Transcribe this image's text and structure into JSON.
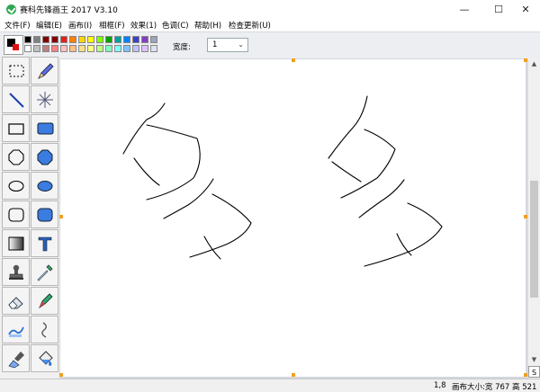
{
  "window": {
    "title": "赛科先锋画王 2017 V3.10",
    "min_glyph": "—",
    "max_glyph": "☐",
    "close_glyph": "✕"
  },
  "menu": [
    {
      "label": "文件(F)"
    },
    {
      "label": "编辑(E)"
    },
    {
      "label": "画布(I)"
    },
    {
      "label": "相框(F)"
    },
    {
      "label": "效果(1)"
    },
    {
      "label": "色调(C)"
    },
    {
      "label": "帮助(H)"
    },
    {
      "label": "检查更新(U)"
    }
  ],
  "toolbar": {
    "width_label": "宽度:",
    "width_value": "1",
    "foreground_color": "#000000",
    "background_color": "#e01010",
    "palette_row1": [
      "#000000",
      "#808080",
      "#800000",
      "#800000",
      "#e02020",
      "#ff8000",
      "#ffd700",
      "#ffff00",
      "#80ff00",
      "#00a000",
      "#00a0a0",
      "#0080ff",
      "#4040c0",
      "#8040c0",
      "#a0a0c0"
    ],
    "palette_row2": [
      "#ffffff",
      "#c0c0c0",
      "#c08080",
      "#ff8080",
      "#ffc0c0",
      "#ffc080",
      "#ffe080",
      "#ffff80",
      "#c0ff80",
      "#80ffc0",
      "#80ffff",
      "#80c0ff",
      "#c0c0ff",
      "#e0c0ff",
      "#e0e0f0"
    ]
  },
  "tools": [
    {
      "name": "select-rect-tool",
      "icon": "dashed-rect"
    },
    {
      "name": "pencil-tool",
      "icon": "pencil"
    },
    {
      "name": "line-tool",
      "icon": "line"
    },
    {
      "name": "spray-tool",
      "icon": "spark"
    },
    {
      "name": "rect-outline-tool",
      "icon": "rect-outline"
    },
    {
      "name": "rect-filled-tool",
      "icon": "rect-filled"
    },
    {
      "name": "octagon-outline-tool",
      "icon": "octagon-outline"
    },
    {
      "name": "octagon-filled-tool",
      "icon": "octagon-filled"
    },
    {
      "name": "ellipse-outline-tool",
      "icon": "ellipse-outline"
    },
    {
      "name": "ellipse-filled-tool",
      "icon": "ellipse-filled"
    },
    {
      "name": "roundrect-outline-tool",
      "icon": "roundrect-outline"
    },
    {
      "name": "roundrect-filled-tool",
      "icon": "roundrect-filled"
    },
    {
      "name": "gradient-tool",
      "icon": "gradient"
    },
    {
      "name": "text-tool",
      "icon": "text-t"
    },
    {
      "name": "stamp-tool",
      "icon": "stamp"
    },
    {
      "name": "eyedropper-tool",
      "icon": "eyedropper"
    },
    {
      "name": "eraser-tool",
      "icon": "eraser"
    },
    {
      "name": "marker-tool",
      "icon": "marker"
    },
    {
      "name": "smudge-tool",
      "icon": "smudge"
    },
    {
      "name": "curve-tool",
      "icon": "curve"
    },
    {
      "name": "airbrush-tool",
      "icon": "airbrush"
    },
    {
      "name": "fill-bucket-tool",
      "icon": "bucket"
    }
  ],
  "scrollbar": {
    "box_label": "S"
  },
  "status": {
    "coords": "1,8",
    "canvas_size": "画布大小:宽 767 高 521"
  }
}
